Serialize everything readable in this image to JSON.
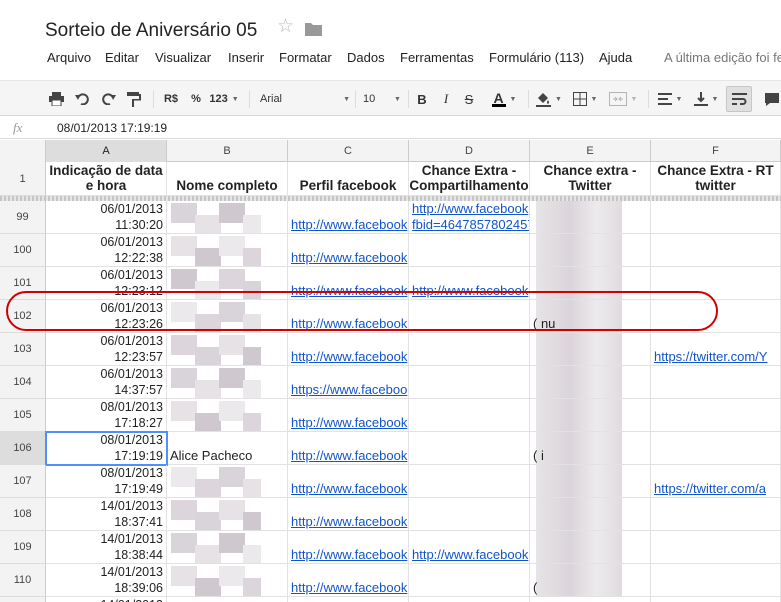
{
  "doc": {
    "title": "Sorteio de Aniversário 05",
    "last_edit": "A última edição foi fe"
  },
  "menu": [
    {
      "label": "Arquivo"
    },
    {
      "label": "Editar"
    },
    {
      "label": "Visualizar"
    },
    {
      "label": "Inserir"
    },
    {
      "label": "Formatar"
    },
    {
      "label": "Dados"
    },
    {
      "label": "Ferramentas"
    },
    {
      "label": "Formulário (113)"
    },
    {
      "label": "Ajuda"
    }
  ],
  "toolbar": {
    "currency_label": "R$",
    "percent_label": "%",
    "number_format_label": "123",
    "font_name": "Arial",
    "font_size": "10",
    "bold_label": "B",
    "italic_label": "I",
    "strike_label": "S",
    "text_color_label": "A",
    "text_color": "#000000"
  },
  "formula_bar": {
    "fx_label": "fx",
    "value": "08/01/2013 17:19:19"
  },
  "columns": [
    {
      "letter": "A",
      "header": "Indicação de data e hora"
    },
    {
      "letter": "B",
      "header": "Nome completo"
    },
    {
      "letter": "C",
      "header": "Perfil facebook"
    },
    {
      "letter": "D",
      "header": "Chance Extra - Compartilhamento"
    },
    {
      "letter": "E",
      "header": "Chance extra - Twitter"
    },
    {
      "letter": "F",
      "header": "Chance Extra - RT twitter"
    }
  ],
  "header_row_number": "1",
  "rows": [
    {
      "num": "99",
      "date": "06/01/2013",
      "time": "11:30:20",
      "name": "",
      "facebook": "http://www.facebook",
      "share": "http://www.facebook",
      "share2": "fbid=4647857802457",
      "twitter": "",
      "rt": ""
    },
    {
      "num": "100",
      "date": "06/01/2013",
      "time": "12:22:38",
      "name": "",
      "facebook": "http://www.facebook",
      "share": "",
      "share2": "",
      "twitter": "",
      "rt": ""
    },
    {
      "num": "101",
      "date": "06/01/2013",
      "time": "12:23:12",
      "name": "",
      "facebook": "http://www.facebook",
      "share": "http://www.facebook",
      "share2": "",
      "twitter": "",
      "rt": ""
    },
    {
      "num": "102",
      "date": "06/01/2013",
      "time": "12:23:26",
      "name": "",
      "facebook": "http://www.facebook",
      "share": "",
      "share2": "",
      "twitter": "(                   nu",
      "rt": ""
    },
    {
      "num": "103",
      "date": "06/01/2013",
      "time": "12:23:57",
      "name": "",
      "facebook": "http://www.facebook",
      "share": "",
      "share2": "",
      "twitter": "",
      "rt": "https://twitter.com/Y"
    },
    {
      "num": "104",
      "date": "06/01/2013",
      "time": "14:37:57",
      "name": "",
      "facebook": "https://www.faceboo",
      "share": "",
      "share2": "",
      "twitter": "",
      "rt": ""
    },
    {
      "num": "105",
      "date": "08/01/2013",
      "time": "17:18:27",
      "name": "",
      "facebook": "http://www.facebook",
      "share": "",
      "share2": "",
      "twitter": "",
      "rt": ""
    },
    {
      "num": "106",
      "date": "08/01/2013",
      "time": "17:19:19",
      "name": "Alice Pacheco",
      "facebook": "http://www.facebook",
      "share": "",
      "share2": "",
      "twitter": "(                   i",
      "rt": ""
    },
    {
      "num": "107",
      "date": "08/01/2013",
      "time": "17:19:49",
      "name": "",
      "facebook": "http://www.facebook",
      "share": "",
      "share2": "",
      "twitter": "",
      "rt": "https://twitter.com/a"
    },
    {
      "num": "108",
      "date": "14/01/2013",
      "time": "18:37:41",
      "name": "",
      "facebook": "http://www.facebook",
      "share": "",
      "share2": "",
      "twitter": "",
      "rt": ""
    },
    {
      "num": "109",
      "date": "14/01/2013",
      "time": "18:38:44",
      "name": "",
      "facebook": "http://www.facebook",
      "share": "http://www.facebook",
      "share2": "",
      "twitter": "",
      "rt": ""
    },
    {
      "num": "110",
      "date": "14/01/2013",
      "time": "18:39:06",
      "name": "",
      "facebook": "http://www.facebook",
      "share": "",
      "share2": "",
      "twitter": "(",
      "rt": ""
    },
    {
      "num": "",
      "date": "14/01/2013",
      "time": "",
      "name": "",
      "facebook": "",
      "share": "",
      "share2": "",
      "twitter": "",
      "rt": ""
    }
  ],
  "colors": {
    "link": "#1155cc",
    "selection": "#4d90fe",
    "highlight_oval": "#d20000"
  },
  "icons": [
    "star-icon",
    "folder-icon",
    "print-icon",
    "undo-icon",
    "redo-icon",
    "paint-format-icon",
    "fill-color-icon",
    "borders-icon",
    "merge-icon",
    "align-left-icon",
    "valign-bottom-icon",
    "wrap-text-icon",
    "comment-icon",
    "fx-icon"
  ]
}
